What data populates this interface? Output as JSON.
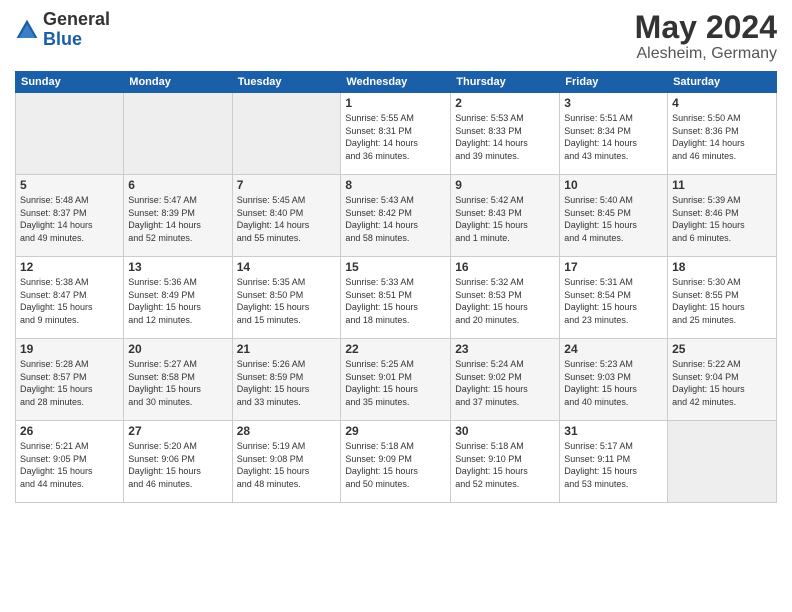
{
  "header": {
    "logo_general": "General",
    "logo_blue": "Blue",
    "month_year": "May 2024",
    "location": "Alesheim, Germany"
  },
  "weekdays": [
    "Sunday",
    "Monday",
    "Tuesday",
    "Wednesday",
    "Thursday",
    "Friday",
    "Saturday"
  ],
  "weeks": [
    [
      {
        "day": "",
        "info": ""
      },
      {
        "day": "",
        "info": ""
      },
      {
        "day": "",
        "info": ""
      },
      {
        "day": "1",
        "info": "Sunrise: 5:55 AM\nSunset: 8:31 PM\nDaylight: 14 hours\nand 36 minutes."
      },
      {
        "day": "2",
        "info": "Sunrise: 5:53 AM\nSunset: 8:33 PM\nDaylight: 14 hours\nand 39 minutes."
      },
      {
        "day": "3",
        "info": "Sunrise: 5:51 AM\nSunset: 8:34 PM\nDaylight: 14 hours\nand 43 minutes."
      },
      {
        "day": "4",
        "info": "Sunrise: 5:50 AM\nSunset: 8:36 PM\nDaylight: 14 hours\nand 46 minutes."
      }
    ],
    [
      {
        "day": "5",
        "info": "Sunrise: 5:48 AM\nSunset: 8:37 PM\nDaylight: 14 hours\nand 49 minutes."
      },
      {
        "day": "6",
        "info": "Sunrise: 5:47 AM\nSunset: 8:39 PM\nDaylight: 14 hours\nand 52 minutes."
      },
      {
        "day": "7",
        "info": "Sunrise: 5:45 AM\nSunset: 8:40 PM\nDaylight: 14 hours\nand 55 minutes."
      },
      {
        "day": "8",
        "info": "Sunrise: 5:43 AM\nSunset: 8:42 PM\nDaylight: 14 hours\nand 58 minutes."
      },
      {
        "day": "9",
        "info": "Sunrise: 5:42 AM\nSunset: 8:43 PM\nDaylight: 15 hours\nand 1 minute."
      },
      {
        "day": "10",
        "info": "Sunrise: 5:40 AM\nSunset: 8:45 PM\nDaylight: 15 hours\nand 4 minutes."
      },
      {
        "day": "11",
        "info": "Sunrise: 5:39 AM\nSunset: 8:46 PM\nDaylight: 15 hours\nand 6 minutes."
      }
    ],
    [
      {
        "day": "12",
        "info": "Sunrise: 5:38 AM\nSunset: 8:47 PM\nDaylight: 15 hours\nand 9 minutes."
      },
      {
        "day": "13",
        "info": "Sunrise: 5:36 AM\nSunset: 8:49 PM\nDaylight: 15 hours\nand 12 minutes."
      },
      {
        "day": "14",
        "info": "Sunrise: 5:35 AM\nSunset: 8:50 PM\nDaylight: 15 hours\nand 15 minutes."
      },
      {
        "day": "15",
        "info": "Sunrise: 5:33 AM\nSunset: 8:51 PM\nDaylight: 15 hours\nand 18 minutes."
      },
      {
        "day": "16",
        "info": "Sunrise: 5:32 AM\nSunset: 8:53 PM\nDaylight: 15 hours\nand 20 minutes."
      },
      {
        "day": "17",
        "info": "Sunrise: 5:31 AM\nSunset: 8:54 PM\nDaylight: 15 hours\nand 23 minutes."
      },
      {
        "day": "18",
        "info": "Sunrise: 5:30 AM\nSunset: 8:55 PM\nDaylight: 15 hours\nand 25 minutes."
      }
    ],
    [
      {
        "day": "19",
        "info": "Sunrise: 5:28 AM\nSunset: 8:57 PM\nDaylight: 15 hours\nand 28 minutes."
      },
      {
        "day": "20",
        "info": "Sunrise: 5:27 AM\nSunset: 8:58 PM\nDaylight: 15 hours\nand 30 minutes."
      },
      {
        "day": "21",
        "info": "Sunrise: 5:26 AM\nSunset: 8:59 PM\nDaylight: 15 hours\nand 33 minutes."
      },
      {
        "day": "22",
        "info": "Sunrise: 5:25 AM\nSunset: 9:01 PM\nDaylight: 15 hours\nand 35 minutes."
      },
      {
        "day": "23",
        "info": "Sunrise: 5:24 AM\nSunset: 9:02 PM\nDaylight: 15 hours\nand 37 minutes."
      },
      {
        "day": "24",
        "info": "Sunrise: 5:23 AM\nSunset: 9:03 PM\nDaylight: 15 hours\nand 40 minutes."
      },
      {
        "day": "25",
        "info": "Sunrise: 5:22 AM\nSunset: 9:04 PM\nDaylight: 15 hours\nand 42 minutes."
      }
    ],
    [
      {
        "day": "26",
        "info": "Sunrise: 5:21 AM\nSunset: 9:05 PM\nDaylight: 15 hours\nand 44 minutes."
      },
      {
        "day": "27",
        "info": "Sunrise: 5:20 AM\nSunset: 9:06 PM\nDaylight: 15 hours\nand 46 minutes."
      },
      {
        "day": "28",
        "info": "Sunrise: 5:19 AM\nSunset: 9:08 PM\nDaylight: 15 hours\nand 48 minutes."
      },
      {
        "day": "29",
        "info": "Sunrise: 5:18 AM\nSunset: 9:09 PM\nDaylight: 15 hours\nand 50 minutes."
      },
      {
        "day": "30",
        "info": "Sunrise: 5:18 AM\nSunset: 9:10 PM\nDaylight: 15 hours\nand 52 minutes."
      },
      {
        "day": "31",
        "info": "Sunrise: 5:17 AM\nSunset: 9:11 PM\nDaylight: 15 hours\nand 53 minutes."
      },
      {
        "day": "",
        "info": ""
      }
    ]
  ]
}
